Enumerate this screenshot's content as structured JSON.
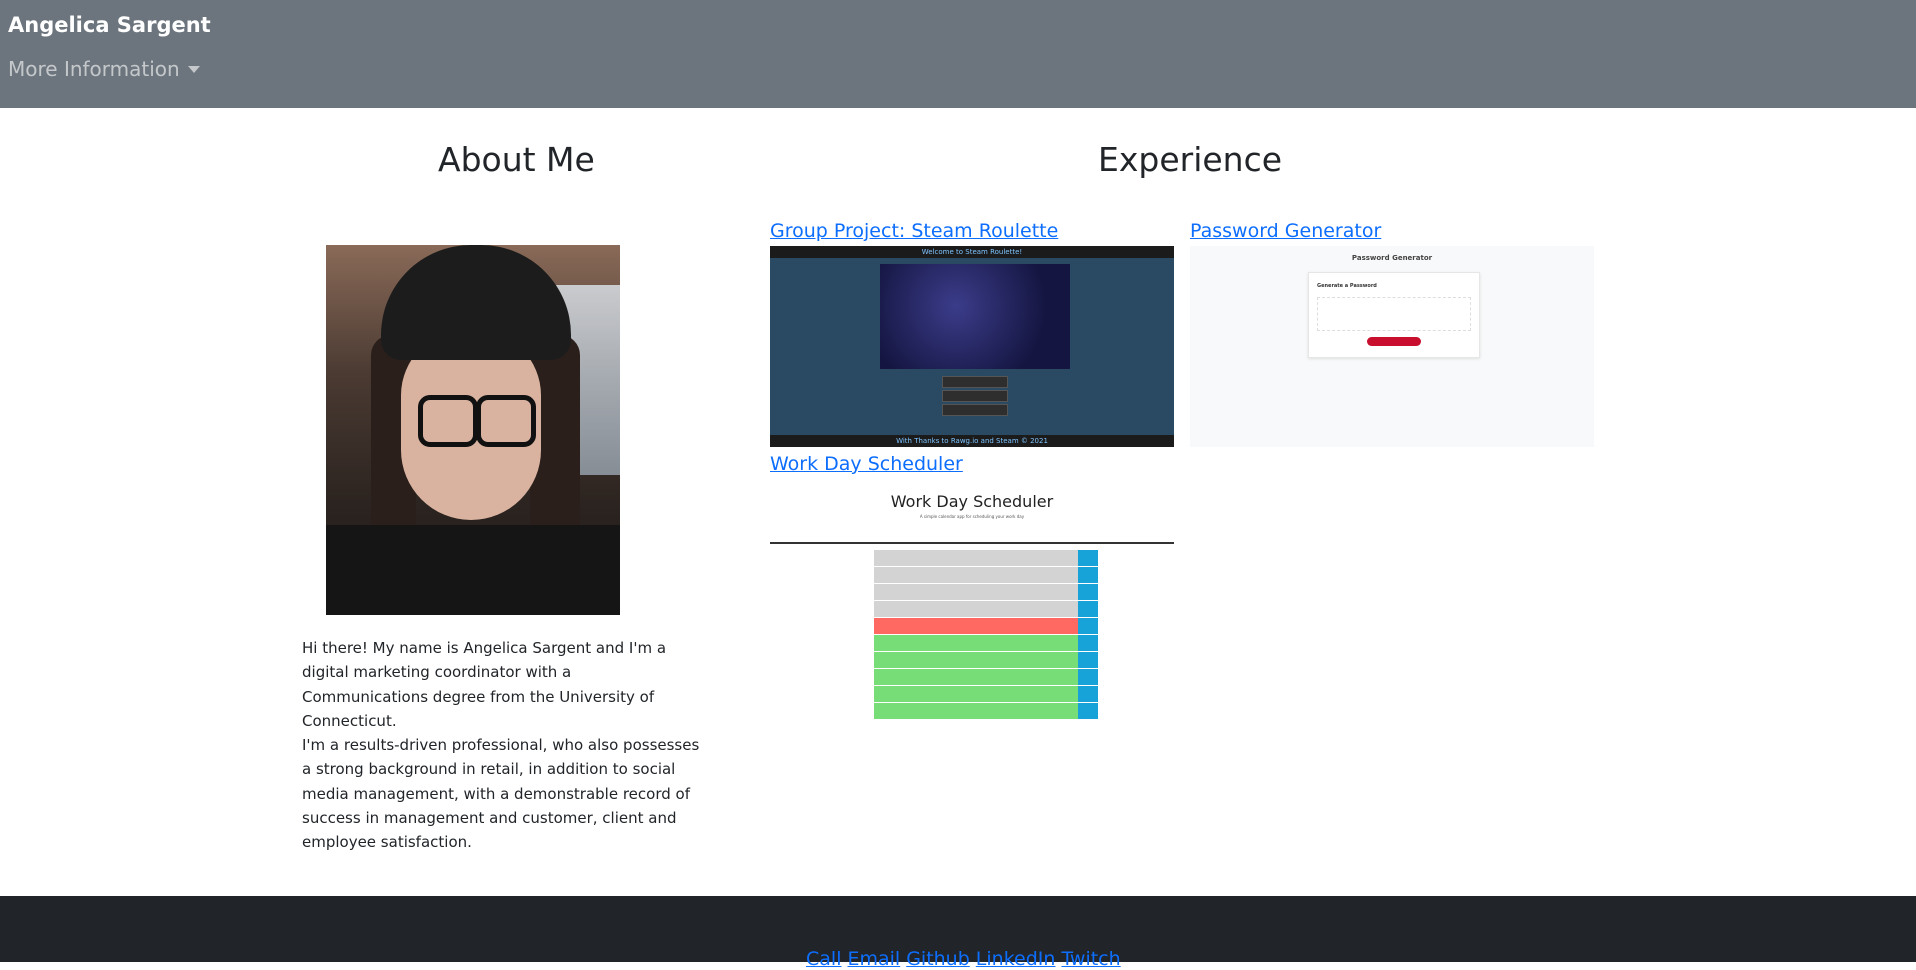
{
  "navbar": {
    "brand": "Angelica Sargent",
    "dropdown_label": "More Information"
  },
  "about": {
    "heading": "About Me",
    "bio_p1": "Hi there! My name is Angelica Sargent and I'm a digital marketing coordinator with a Communications degree from the University of Connecticut.",
    "bio_p2": "I'm a results-driven professional, who also possesses a strong background in retail, in addition to social media management, with a demonstrable record of success in management and customer, client and employee satisfaction."
  },
  "experience": {
    "heading": "Experience",
    "projects": [
      {
        "title": "Group Project: Steam Roulette",
        "thumb_header": "Welcome to Steam Roulette!",
        "thumb_footer": "With Thanks to Rawg.io and Steam © 2021"
      },
      {
        "title": "Password Generator",
        "thumb_title": "Password Generator",
        "thumb_label": "Generate a Password"
      },
      {
        "title": "Work Day Scheduler",
        "thumb_title": "Work Day Scheduler",
        "thumb_subtitle": "A simple calendar app for scheduling your work day"
      }
    ]
  },
  "footer": {
    "links": [
      "Call",
      "Email",
      "Github",
      "LinkedIn",
      "Twitch"
    ]
  },
  "colors": {
    "navbar": "#6c757d",
    "footer": "#212529",
    "link": "#0d6efd",
    "past": "#d3d3d3",
    "present": "#ff6961",
    "future": "#77dd77"
  }
}
